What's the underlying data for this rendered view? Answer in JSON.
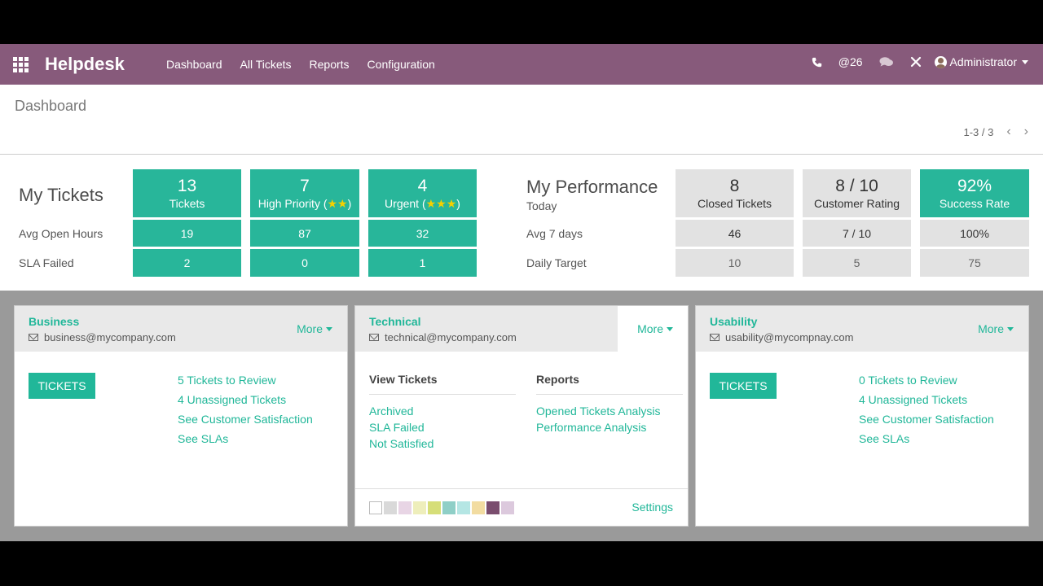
{
  "navbar": {
    "brand": "Helpdesk",
    "menu": [
      "Dashboard",
      "All Tickets",
      "Reports",
      "Configuration"
    ],
    "mentions_count": "@26",
    "user": "Administrator"
  },
  "control_panel": {
    "breadcrumb": "Dashboard",
    "pager": "1-3 / 3"
  },
  "my_tickets": {
    "title": "My Tickets",
    "rows": [
      "Avg Open Hours",
      "SLA Failed"
    ],
    "columns": [
      {
        "value": "13",
        "label": "Tickets",
        "stars": "",
        "avg": "19",
        "sla": "2"
      },
      {
        "value": "7",
        "label": "High Priority (",
        "stars": "★★",
        "suffix": ")",
        "avg": "87",
        "sla": "0"
      },
      {
        "value": "4",
        "label": "Urgent (",
        "stars": "★★★",
        "suffix": ")",
        "avg": "32",
        "sla": "1"
      }
    ]
  },
  "my_performance": {
    "title": "My Performance",
    "rows": [
      "Today",
      "Avg 7 days",
      "Daily Target"
    ],
    "columns": [
      {
        "value": "8",
        "label": "Closed Tickets",
        "avg": "46",
        "target": "10"
      },
      {
        "value": "8 / 10",
        "label": "Customer Rating",
        "avg": "7 / 10",
        "target": "5"
      },
      {
        "value": "92%",
        "label": "Success Rate",
        "avg": "100%",
        "target": "75"
      }
    ]
  },
  "teams": [
    {
      "name": "Business",
      "email": "business@mycompany.com",
      "more": "More",
      "button": "TICKETS",
      "links": [
        "5 Tickets to Review",
        "4 Unassigned Tickets",
        "See Customer Satisfaction",
        "See SLAs"
      ]
    },
    {
      "name": "Technical",
      "email": "technical@mycompany.com",
      "more": "More",
      "view_head": "View Tickets",
      "view_links": [
        "Archived",
        "SLA Failed",
        "Not Satisfied"
      ],
      "reports_head": "Reports",
      "reports_links": [
        "Opened Tickets Analysis",
        "Performance Analysis"
      ],
      "settings": "Settings",
      "swatches": [
        "#ffffff",
        "#d9d9d9",
        "#e8d5e5",
        "#eeeebb",
        "#d6de78",
        "#8fcfc7",
        "#b5e6e4",
        "#f2dca1",
        "#7a4d6e",
        "#dcc9dd"
      ]
    },
    {
      "name": "Usability",
      "email": "usability@mycompnay.com",
      "more": "More",
      "button": "TICKETS",
      "links": [
        "0 Tickets to Review",
        "4 Unassigned Tickets",
        "See Customer Satisfaction",
        "See SLAs"
      ]
    }
  ],
  "colors": {
    "navbar": "#875a7b",
    "accent": "#21b799",
    "stat_green": "#28b69a",
    "stat_grey": "#e2e2e2"
  }
}
